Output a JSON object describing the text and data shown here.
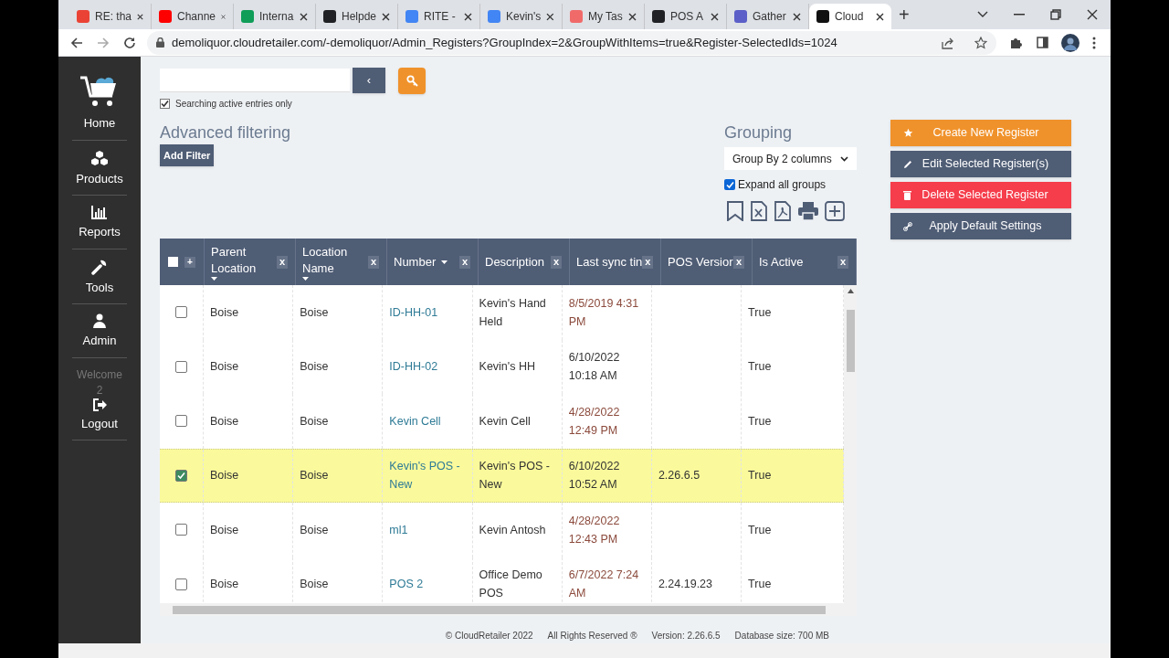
{
  "browser": {
    "tabs": [
      {
        "title": "RE: tha",
        "color": "#ea4335",
        "selected": false
      },
      {
        "title": "Channe",
        "color": "#ff0000",
        "selected": false
      },
      {
        "title": "Interna",
        "color": "#0f9d58",
        "selected": false
      },
      {
        "title": "Helpde",
        "color": "#202124",
        "selected": false
      },
      {
        "title": "RITE -",
        "color": "#4285f4",
        "selected": false
      },
      {
        "title": "Kevin's",
        "color": "#4285f4",
        "selected": false
      },
      {
        "title": "My Tas",
        "color": "#f06a6a",
        "selected": false
      },
      {
        "title": "POS A",
        "color": "#202124",
        "selected": false
      },
      {
        "title": "Gather",
        "color": "#5b5fc7",
        "selected": false
      },
      {
        "title": "Cloud",
        "color": "#111111",
        "selected": true
      }
    ],
    "new_tab": "+",
    "url": "demoliquor.cloudretailer.com/-demoliquor/Admin_Registers?GroupIndex=2&GroupWithItems=true&Register-SelectedIds=1024"
  },
  "sidebar": {
    "items": [
      {
        "kind": "home",
        "label": "Home"
      },
      {
        "kind": "products",
        "label": "Products"
      },
      {
        "kind": "reports",
        "label": "Reports"
      },
      {
        "kind": "tools",
        "label": "Tools"
      },
      {
        "kind": "admin",
        "label": "Admin"
      }
    ],
    "welcome": "Welcome",
    "user": "2",
    "logout": "Logout"
  },
  "search": {
    "back": "‹",
    "active_only": {
      "label": "Searching active entries only",
      "checked": true
    }
  },
  "filtering": {
    "title": "Advanced filtering",
    "add_filter": "Add Filter"
  },
  "grouping": {
    "title": "Grouping",
    "value": "Group By 2 columns",
    "expand_all": {
      "label": "Expand all groups",
      "checked": true
    }
  },
  "actions": [
    {
      "kind": "create",
      "label": "Create New Register"
    },
    {
      "kind": "edit",
      "label": "Edit Selected Register(s)"
    },
    {
      "kind": "delete",
      "label": "Delete Selected Register"
    },
    {
      "kind": "apply",
      "label": "Apply Default Settings"
    }
  ],
  "table": {
    "select_all": {
      "checked": false
    },
    "expand": "+",
    "columns": [
      {
        "label": "Parent Location",
        "sortable": true,
        "remove": "x"
      },
      {
        "label": "Location Name",
        "sortable": true,
        "remove": "x"
      },
      {
        "label": "Number",
        "sortable": true,
        "remove": "x"
      },
      {
        "label": "Description",
        "sortable": false,
        "remove": "x"
      },
      {
        "label": "Last sync tin",
        "sortable": false,
        "remove": "x"
      },
      {
        "label": "POS Versior",
        "sortable": false,
        "remove": "x"
      },
      {
        "label": "Is Active",
        "sortable": false,
        "remove": "x"
      }
    ],
    "rows": [
      {
        "selected": false,
        "cells": [
          "Boise",
          "Boise",
          "ID-HH-01",
          "Kevin's Hand Held",
          "8/5/2019 4:31 PM",
          "",
          "True"
        ],
        "color": "#8b4a3c"
      },
      {
        "selected": false,
        "cells": [
          "Boise",
          "Boise",
          "ID-HH-02",
          "Kevin's HH",
          "6/10/2022 10:18 AM",
          "",
          "True"
        ],
        "color": "#333333"
      },
      {
        "selected": false,
        "cells": [
          "Boise",
          "Boise",
          "Kevin Cell",
          "Kevin Cell",
          "4/28/2022 12:49 PM",
          "",
          "True"
        ],
        "color": "#8b4a3c"
      },
      {
        "selected": true,
        "cells": [
          "Boise",
          "Boise",
          "Kevin's POS - New",
          "Kevin's POS - New",
          "6/10/2022 10:52 AM",
          "2.26.6.5",
          "True"
        ],
        "color": "#333333"
      },
      {
        "selected": false,
        "cells": [
          "Boise",
          "Boise",
          "ml1",
          "Kevin Antosh",
          "4/28/2022 12:43 PM",
          "",
          "True"
        ],
        "color": "#8b4a3c"
      },
      {
        "selected": false,
        "cells": [
          "Boise",
          "Boise",
          "POS 2",
          "Office Demo POS",
          "6/7/2022 7:24 AM",
          "2.24.19.23",
          "True"
        ],
        "color": "#8b4a3c"
      }
    ]
  },
  "footer": [
    "© CloudRetailer 2022",
    "All Rights Reserved ®",
    "Version: 2.26.6.5",
    "Database size: 700 MB"
  ]
}
